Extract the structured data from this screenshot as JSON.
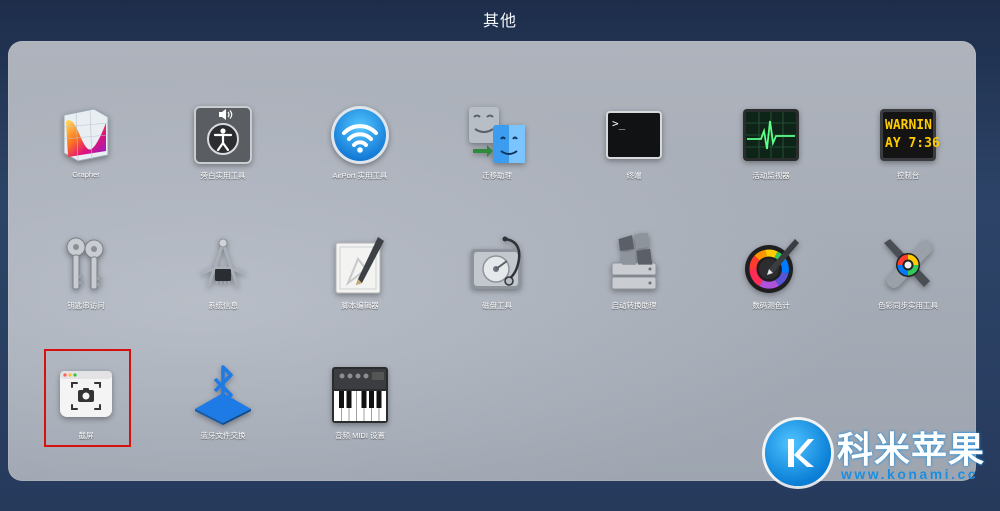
{
  "folder": {
    "title": "其他"
  },
  "apps": {
    "grapher": "Grapher",
    "voiceover": "旁白实用工具",
    "airport": "AirPort 实用工具",
    "migration": "迁移助理",
    "terminal": "终端",
    "activity_monitor": "活动监视器",
    "console": "控制台",
    "console_icon_line1": "WARNIN",
    "console_icon_line2": "AY 7:36",
    "terminal_icon_prompt": ">_",
    "keychain": "钥匙串访问",
    "system_info": "系统信息",
    "script_editor": "脚本编辑器",
    "disk_utility": "磁盘工具",
    "boot_camp": "启动转换助理",
    "digital_color_meter": "数码测色计",
    "colorsync": "色彩同步实用工具",
    "screenshot": "截屏",
    "bluetooth": "蓝牙文件交换",
    "midi": "音频 MIDI 设置"
  },
  "watermark": {
    "cn": "科米苹果",
    "en": "www.konami.cc"
  },
  "colors": {
    "selection_highlight": "#d60f0f",
    "watermark_blue": "#1a8fe0"
  }
}
